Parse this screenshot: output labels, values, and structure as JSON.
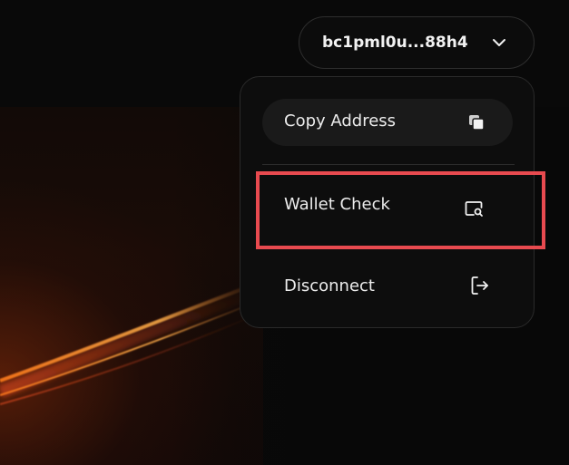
{
  "wallet": {
    "address_label": "bc1pml0u...88h4",
    "chevron_icon": "chevron-down-icon"
  },
  "menu": {
    "items": [
      {
        "label": "Copy Address",
        "icon": "copy-icon"
      },
      {
        "label": "Wallet Check",
        "icon": "search-window-icon"
      },
      {
        "label": "Disconnect",
        "icon": "logout-icon"
      }
    ]
  },
  "colors": {
    "background": "#090909",
    "menu_background": "#0d0d0d",
    "copy_row_background": "#1a1a1a",
    "text": "#ececec",
    "highlight": "#e84a4f",
    "accent_glow": "#ff8a2a"
  }
}
